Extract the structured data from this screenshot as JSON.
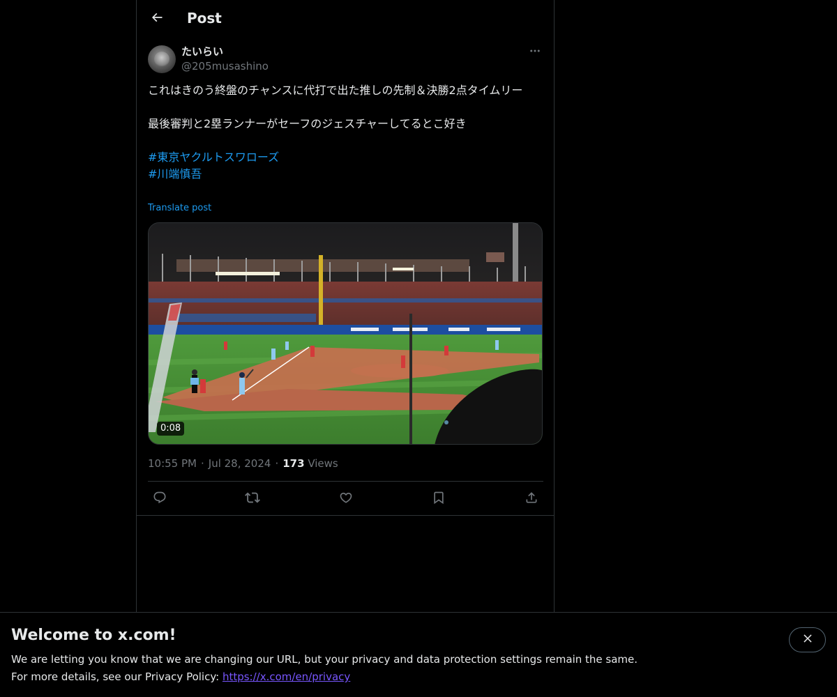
{
  "header": {
    "back_icon": "arrow-left-icon",
    "title": "Post"
  },
  "post": {
    "author": {
      "display_name": "たいらい",
      "handle": "@205musashino",
      "avatar_icon": "avatar-photo"
    },
    "more_icon": "ellipsis-icon",
    "text": {
      "line1": "これはきのう終盤のチャンスに代打で出た推しの先制＆決勝2点タイムリー",
      "line2": "最後審判と2塁ランナーがセーフのジェスチャーしてるとこ好き",
      "hashtags": [
        "#東京ヤクルトスワローズ",
        "#川端慎吾"
      ]
    },
    "translate_label": "Translate post",
    "media": {
      "type": "video",
      "duration": "0:08"
    },
    "meta": {
      "time": "10:55 PM",
      "separator": "·",
      "date": "Jul 28, 2024",
      "views_count": "173",
      "views_label": "Views"
    },
    "actions": [
      {
        "name": "reply",
        "icon": "reply-icon"
      },
      {
        "name": "repost",
        "icon": "repost-icon"
      },
      {
        "name": "like",
        "icon": "heart-icon"
      },
      {
        "name": "bookmark",
        "icon": "bookmark-icon"
      },
      {
        "name": "share",
        "icon": "share-icon"
      }
    ]
  },
  "banner": {
    "title": "Welcome to x.com!",
    "line1": "We are letting you know that we are changing our URL, but your privacy and data protection settings remain the same.",
    "line2_prefix": "For more details, see our Privacy Policy: ",
    "link_text": "https://x.com/en/privacy",
    "close_icon": "close-icon"
  },
  "colors": {
    "background": "#000000",
    "text_primary": "#e7e9ea",
    "text_secondary": "#71767b",
    "accent": "#1d9bf0",
    "link_banner": "#7856ff",
    "border": "#2f3336"
  }
}
